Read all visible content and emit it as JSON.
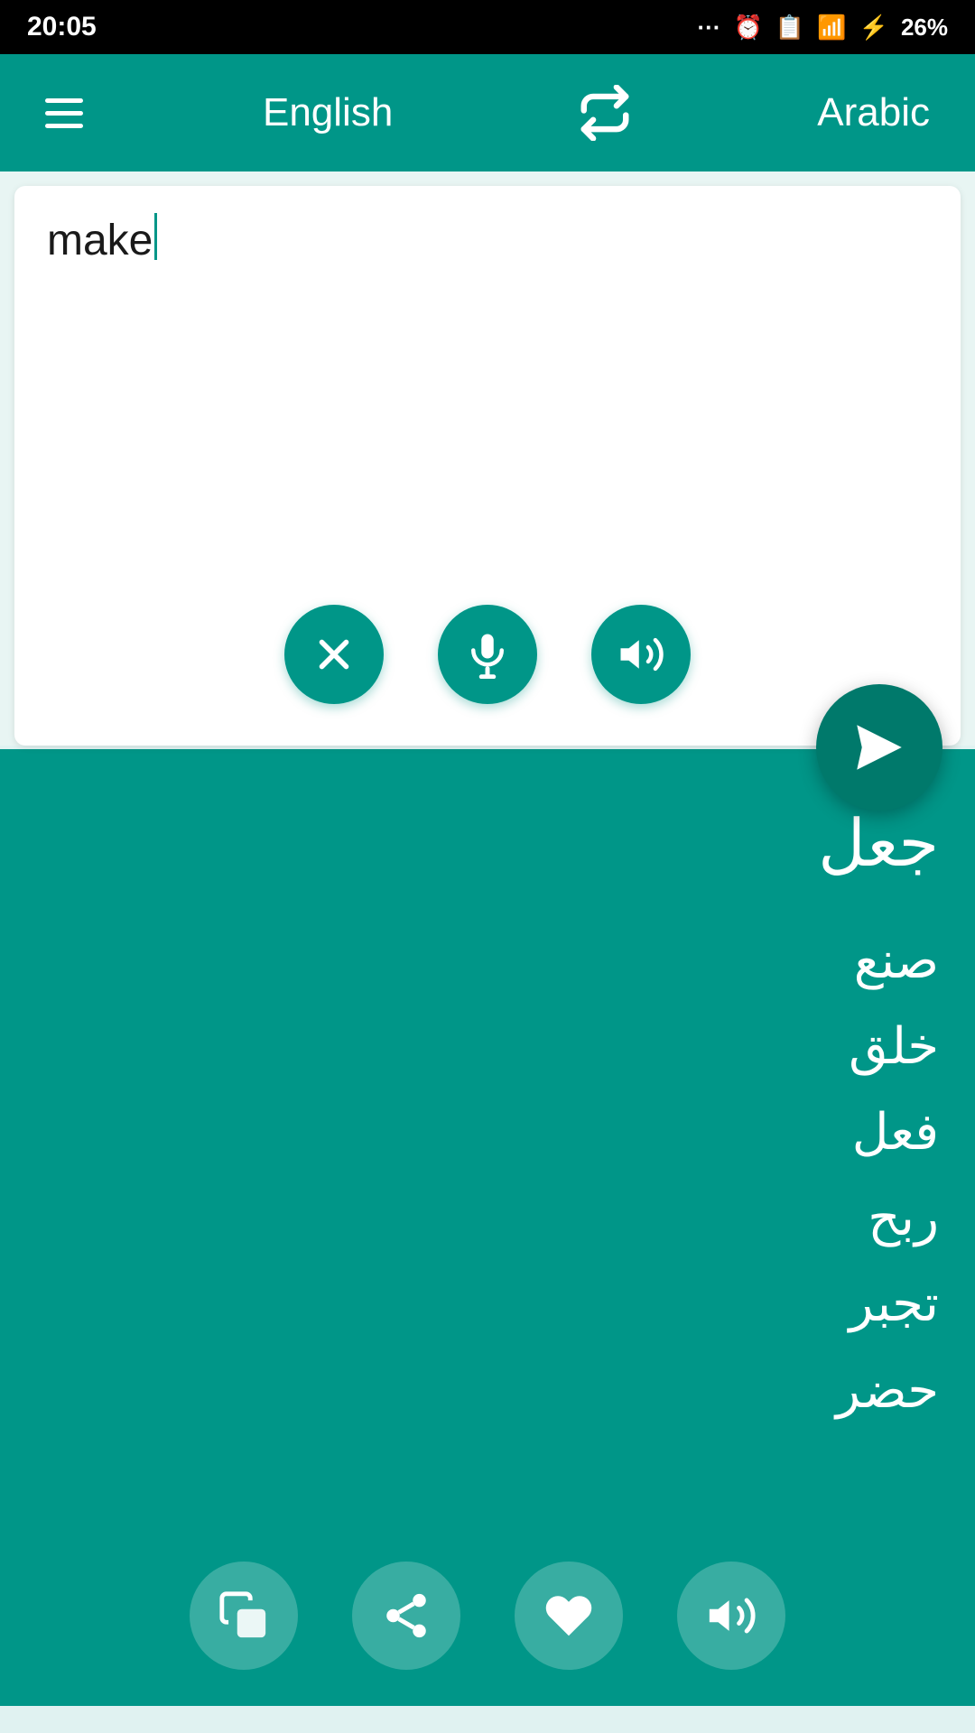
{
  "statusBar": {
    "time": "20:05",
    "battery": "26%"
  },
  "toolbar": {
    "menuLabel": "menu",
    "sourceLang": "English",
    "swapLabel": "swap languages",
    "targetLang": "Arabic"
  },
  "inputCard": {
    "inputText": "make",
    "clearLabel": "clear",
    "micLabel": "microphone",
    "speakLabel": "speak",
    "translateLabel": "translate"
  },
  "outputCard": {
    "mainTranslation": "جعل",
    "alternates": "صنع\nخلق\nفعل\nربح\nتجبر\nحضر",
    "copyLabel": "copy",
    "shareLabel": "share",
    "favoriteLabel": "favorite",
    "speakLabel": "speak"
  }
}
